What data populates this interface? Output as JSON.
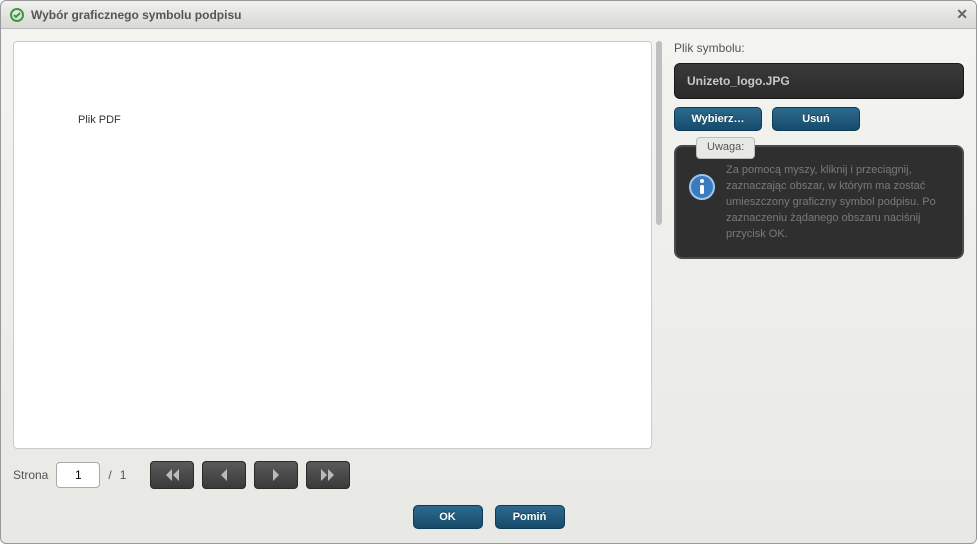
{
  "window": {
    "title": "Wybór graficznego symbolu podpisu"
  },
  "preview": {
    "label": "Plik PDF"
  },
  "pager": {
    "label": "Strona",
    "current": "1",
    "separator": "/",
    "total": "1"
  },
  "right": {
    "file_label": "Plik symbolu:",
    "file_value": "Unizeto_logo.JPG",
    "choose_label": "Wybierz…",
    "delete_label": "Usuń",
    "info_tab": "Uwaga:",
    "info_text": "Za pomocą myszy, kliknij i przeciągnij, zaznaczając obszar, w którym  ma zostać umieszczony graficzny symbol podpisu. Po zaznaczeniu żądanego obszaru naciśnij przycisk OK."
  },
  "footer": {
    "ok_label": "OK",
    "skip_label": "Pomiń"
  }
}
